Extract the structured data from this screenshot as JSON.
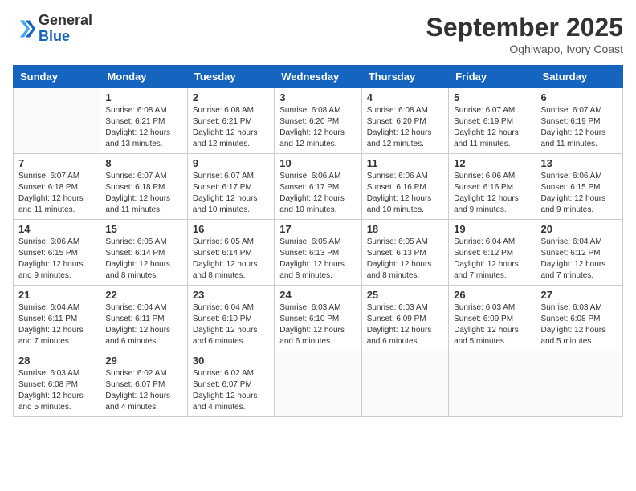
{
  "logo": {
    "general": "General",
    "blue": "Blue"
  },
  "title": {
    "month": "September 2025",
    "location": "Oghlwapo, Ivory Coast"
  },
  "days_header": [
    "Sunday",
    "Monday",
    "Tuesday",
    "Wednesday",
    "Thursday",
    "Friday",
    "Saturday"
  ],
  "weeks": [
    [
      {
        "day": "",
        "info": ""
      },
      {
        "day": "1",
        "info": "Sunrise: 6:08 AM\nSunset: 6:21 PM\nDaylight: 12 hours\nand 13 minutes."
      },
      {
        "day": "2",
        "info": "Sunrise: 6:08 AM\nSunset: 6:21 PM\nDaylight: 12 hours\nand 12 minutes."
      },
      {
        "day": "3",
        "info": "Sunrise: 6:08 AM\nSunset: 6:20 PM\nDaylight: 12 hours\nand 12 minutes."
      },
      {
        "day": "4",
        "info": "Sunrise: 6:08 AM\nSunset: 6:20 PM\nDaylight: 12 hours\nand 12 minutes."
      },
      {
        "day": "5",
        "info": "Sunrise: 6:07 AM\nSunset: 6:19 PM\nDaylight: 12 hours\nand 11 minutes."
      },
      {
        "day": "6",
        "info": "Sunrise: 6:07 AM\nSunset: 6:19 PM\nDaylight: 12 hours\nand 11 minutes."
      }
    ],
    [
      {
        "day": "7",
        "info": "Sunrise: 6:07 AM\nSunset: 6:18 PM\nDaylight: 12 hours\nand 11 minutes."
      },
      {
        "day": "8",
        "info": "Sunrise: 6:07 AM\nSunset: 6:18 PM\nDaylight: 12 hours\nand 11 minutes."
      },
      {
        "day": "9",
        "info": "Sunrise: 6:07 AM\nSunset: 6:17 PM\nDaylight: 12 hours\nand 10 minutes."
      },
      {
        "day": "10",
        "info": "Sunrise: 6:06 AM\nSunset: 6:17 PM\nDaylight: 12 hours\nand 10 minutes."
      },
      {
        "day": "11",
        "info": "Sunrise: 6:06 AM\nSunset: 6:16 PM\nDaylight: 12 hours\nand 10 minutes."
      },
      {
        "day": "12",
        "info": "Sunrise: 6:06 AM\nSunset: 6:16 PM\nDaylight: 12 hours\nand 9 minutes."
      },
      {
        "day": "13",
        "info": "Sunrise: 6:06 AM\nSunset: 6:15 PM\nDaylight: 12 hours\nand 9 minutes."
      }
    ],
    [
      {
        "day": "14",
        "info": "Sunrise: 6:06 AM\nSunset: 6:15 PM\nDaylight: 12 hours\nand 9 minutes."
      },
      {
        "day": "15",
        "info": "Sunrise: 6:05 AM\nSunset: 6:14 PM\nDaylight: 12 hours\nand 8 minutes."
      },
      {
        "day": "16",
        "info": "Sunrise: 6:05 AM\nSunset: 6:14 PM\nDaylight: 12 hours\nand 8 minutes."
      },
      {
        "day": "17",
        "info": "Sunrise: 6:05 AM\nSunset: 6:13 PM\nDaylight: 12 hours\nand 8 minutes."
      },
      {
        "day": "18",
        "info": "Sunrise: 6:05 AM\nSunset: 6:13 PM\nDaylight: 12 hours\nand 8 minutes."
      },
      {
        "day": "19",
        "info": "Sunrise: 6:04 AM\nSunset: 6:12 PM\nDaylight: 12 hours\nand 7 minutes."
      },
      {
        "day": "20",
        "info": "Sunrise: 6:04 AM\nSunset: 6:12 PM\nDaylight: 12 hours\nand 7 minutes."
      }
    ],
    [
      {
        "day": "21",
        "info": "Sunrise: 6:04 AM\nSunset: 6:11 PM\nDaylight: 12 hours\nand 7 minutes."
      },
      {
        "day": "22",
        "info": "Sunrise: 6:04 AM\nSunset: 6:11 PM\nDaylight: 12 hours\nand 6 minutes."
      },
      {
        "day": "23",
        "info": "Sunrise: 6:04 AM\nSunset: 6:10 PM\nDaylight: 12 hours\nand 6 minutes."
      },
      {
        "day": "24",
        "info": "Sunrise: 6:03 AM\nSunset: 6:10 PM\nDaylight: 12 hours\nand 6 minutes."
      },
      {
        "day": "25",
        "info": "Sunrise: 6:03 AM\nSunset: 6:09 PM\nDaylight: 12 hours\nand 6 minutes."
      },
      {
        "day": "26",
        "info": "Sunrise: 6:03 AM\nSunset: 6:09 PM\nDaylight: 12 hours\nand 5 minutes."
      },
      {
        "day": "27",
        "info": "Sunrise: 6:03 AM\nSunset: 6:08 PM\nDaylight: 12 hours\nand 5 minutes."
      }
    ],
    [
      {
        "day": "28",
        "info": "Sunrise: 6:03 AM\nSunset: 6:08 PM\nDaylight: 12 hours\nand 5 minutes."
      },
      {
        "day": "29",
        "info": "Sunrise: 6:02 AM\nSunset: 6:07 PM\nDaylight: 12 hours\nand 4 minutes."
      },
      {
        "day": "30",
        "info": "Sunrise: 6:02 AM\nSunset: 6:07 PM\nDaylight: 12 hours\nand 4 minutes."
      },
      {
        "day": "",
        "info": ""
      },
      {
        "day": "",
        "info": ""
      },
      {
        "day": "",
        "info": ""
      },
      {
        "day": "",
        "info": ""
      }
    ]
  ]
}
